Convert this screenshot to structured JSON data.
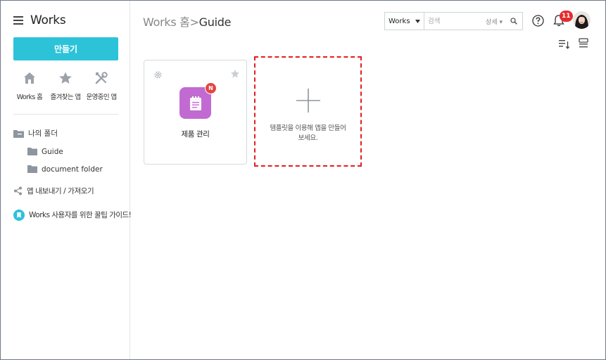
{
  "sidebar": {
    "title": "Works",
    "create_button": "만들기",
    "quick": [
      {
        "label": "Works 홈",
        "icon": "home-icon"
      },
      {
        "label": "즐겨찾는 앱",
        "icon": "star-icon"
      },
      {
        "label": "운영중인 앱",
        "icon": "tools-icon"
      }
    ],
    "folders": {
      "root": "나의 폴더",
      "items": [
        "Guide",
        "document folder"
      ]
    },
    "export": "앱 내보내기 / 가져오기",
    "guide": "Works 사용자를 위한 꿀팁 가이드!"
  },
  "header": {
    "breadcrumb_home": "Works 홈",
    "breadcrumb_sep": ">",
    "breadcrumb_current": "Guide",
    "search_scope": "Works",
    "search_placeholder": "검색",
    "search_detail": "상세",
    "notification_count": "11"
  },
  "cards": [
    {
      "name": "제품 관리",
      "badge": "N",
      "icon_color": "#c16bd2"
    }
  ],
  "add_card": {
    "line1": "템플릿을 이용해 앱을 만들어",
    "line2": "보세요."
  },
  "colors": {
    "accent": "#2cc3d9",
    "badge_red": "#e52c2c",
    "highlight_dash": "#e21f1f"
  }
}
